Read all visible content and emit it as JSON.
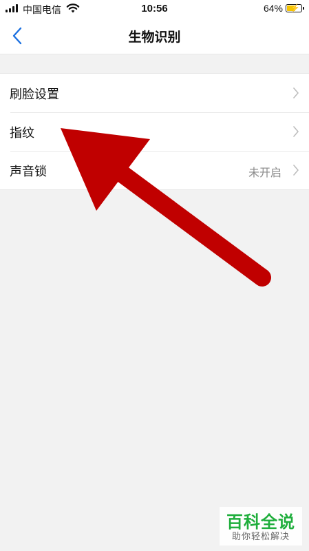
{
  "status_bar": {
    "carrier": "中国电信",
    "time": "10:56",
    "battery_percent": "64%",
    "battery_level": 0.64
  },
  "nav": {
    "title": "生物识别",
    "back_icon": "chevron-left-icon"
  },
  "settings": {
    "items": [
      {
        "label": "刷脸设置",
        "value": ""
      },
      {
        "label": "指纹",
        "value": ""
      },
      {
        "label": "声音锁",
        "value": "未开启"
      }
    ]
  },
  "watermark": {
    "title": "百科全说",
    "subtitle": "助你轻松解决"
  },
  "colors": {
    "accent": "#1a6fe0",
    "annotation_arrow": "#c00000",
    "watermark_green": "#1fae3c"
  }
}
